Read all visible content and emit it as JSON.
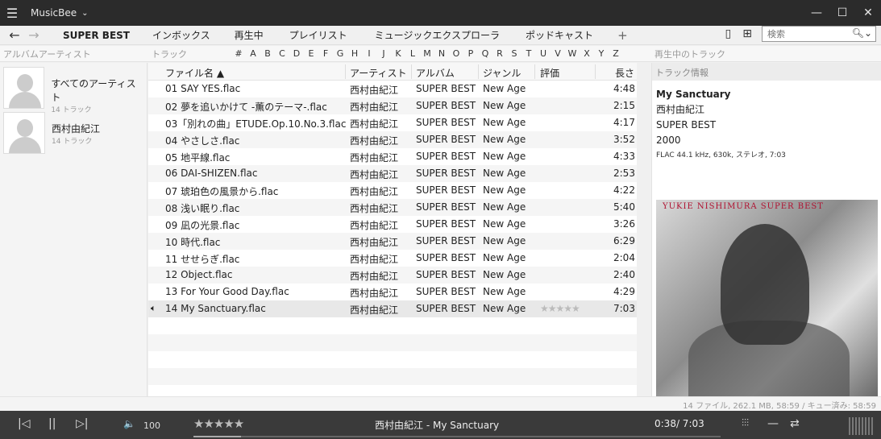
{
  "titlebar": {
    "title": "MusicBee",
    "dropdown": "⌄",
    "menu": "☰",
    "minimize": "—",
    "maximize": "☐",
    "close": "✕"
  },
  "nav": {
    "back": "←",
    "forward": "→",
    "tabs": [
      "SUPER BEST",
      "インボックス",
      "再生中",
      "プレイリスト",
      "ミュージックエクスプローラ",
      "ポッドキャスト"
    ],
    "plus": "+",
    "search_placeholder": "検索",
    "phone_icon": "▯",
    "layout_icon": "⊞"
  },
  "strip": {
    "album_artist": "アルバムアーティスト",
    "track": "トラック",
    "letters": [
      "#",
      "A",
      "B",
      "C",
      "D",
      "E",
      "F",
      "G",
      "H",
      "I",
      "J",
      "K",
      "L",
      "M",
      "N",
      "O",
      "P",
      "Q",
      "R",
      "S",
      "T",
      "U",
      "V",
      "W",
      "X",
      "Y",
      "Z"
    ],
    "now_playing": "再生中のトラック"
  },
  "artists": [
    {
      "name": "すべてのアーティスト",
      "count": "14 トラック"
    },
    {
      "name": "西村由紀江",
      "count": "14 トラック"
    }
  ],
  "columns": {
    "file": "ファイル名 ▲",
    "artist": "アーティスト",
    "album": "アルバム",
    "genre": "ジャンル",
    "rating": "評価",
    "length": "長さ"
  },
  "tracks": [
    {
      "file": "01 SAY YES.flac",
      "artist": "西村由紀江",
      "album": "SUPER BEST",
      "genre": "New Age",
      "rating": "",
      "length": "4:48"
    },
    {
      "file": "02 夢を追いかけて -薫のテーマ-.flac",
      "artist": "西村由紀江",
      "album": "SUPER BEST",
      "genre": "New Age",
      "rating": "",
      "length": "2:15"
    },
    {
      "file": "03「別れの曲」ETUDE.Op.10.No.3.flac",
      "artist": "西村由紀江",
      "album": "SUPER BEST",
      "genre": "New Age",
      "rating": "",
      "length": "4:17"
    },
    {
      "file": "04 やさしさ.flac",
      "artist": "西村由紀江",
      "album": "SUPER BEST",
      "genre": "New Age",
      "rating": "",
      "length": "3:52"
    },
    {
      "file": "05 地平線.flac",
      "artist": "西村由紀江",
      "album": "SUPER BEST",
      "genre": "New Age",
      "rating": "",
      "length": "4:33"
    },
    {
      "file": "06 DAI-SHIZEN.flac",
      "artist": "西村由紀江",
      "album": "SUPER BEST",
      "genre": "New Age",
      "rating": "",
      "length": "2:53"
    },
    {
      "file": "07 琥珀色の風景から.flac",
      "artist": "西村由紀江",
      "album": "SUPER BEST",
      "genre": "New Age",
      "rating": "",
      "length": "4:22"
    },
    {
      "file": "08 浅い眠り.flac",
      "artist": "西村由紀江",
      "album": "SUPER BEST",
      "genre": "New Age",
      "rating": "",
      "length": "5:40"
    },
    {
      "file": "09 凪の光景.flac",
      "artist": "西村由紀江",
      "album": "SUPER BEST",
      "genre": "New Age",
      "rating": "",
      "length": "3:26"
    },
    {
      "file": "10 時代.flac",
      "artist": "西村由紀江",
      "album": "SUPER BEST",
      "genre": "New Age",
      "rating": "",
      "length": "6:29"
    },
    {
      "file": "11 せせらぎ.flac",
      "artist": "西村由紀江",
      "album": "SUPER BEST",
      "genre": "New Age",
      "rating": "",
      "length": "2:04"
    },
    {
      "file": "12 Object.flac",
      "artist": "西村由紀江",
      "album": "SUPER BEST",
      "genre": "New Age",
      "rating": "",
      "length": "2:40"
    },
    {
      "file": "13 For Your Good Day.flac",
      "artist": "西村由紀江",
      "album": "SUPER BEST",
      "genre": "New Age",
      "rating": "",
      "length": "4:29"
    },
    {
      "file": "14 My Sanctuary.flac",
      "artist": "西村由紀江",
      "album": "SUPER BEST",
      "genre": "New Age",
      "rating": "★★★★★",
      "length": "7:03",
      "playing": true
    }
  ],
  "track_info": {
    "header": "トラック情報",
    "title": "My Sanctuary",
    "artist": "西村由紀江",
    "album": "SUPER BEST",
    "year": "2000",
    "format": "FLAC 44.1 kHz, 630k, ステレオ, 7:03"
  },
  "cover": {
    "text": "YUKIE NISHIMURA SUPER BEST"
  },
  "status": "14 ファイル, 262.1 MB, 58:59 /   キュー済み: 58:59",
  "player": {
    "prev": "|◁",
    "pause": "||",
    "next": "▷|",
    "volume_icon": "🔈",
    "volume": "100",
    "rating": "★★★★★",
    "now_playing": "西村由紀江 - My Sanctuary",
    "time": "0:38/ 7:03",
    "progress": 0.09,
    "eq_icon": "⫶⫶⫶",
    "shuffle_icon": "—",
    "repeat_icon": "⇄"
  }
}
